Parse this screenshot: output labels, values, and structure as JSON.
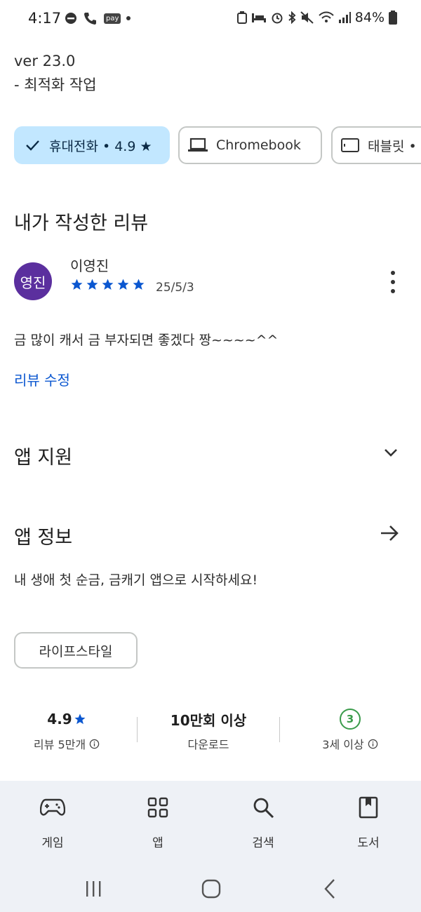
{
  "status_bar": {
    "time": "4:17",
    "pay_label": "pay",
    "battery": "84%"
  },
  "version": {
    "line1": "ver 23.0",
    "line2": "- 최적화 작업"
  },
  "device_chips": [
    {
      "label": "휴대전화 • 4.9 ★",
      "selected": true
    },
    {
      "label": "Chromebook",
      "selected": false
    },
    {
      "label": "태블릿 • ",
      "selected": false
    }
  ],
  "my_review": {
    "title": "내가 작성한 리뷰",
    "avatar_text": "영진",
    "avatar_color": "#5b2f9e",
    "reviewer": "이영진",
    "stars": 5,
    "date": "25/5/3",
    "text": "금 많이 캐서 금 부자되면 좋겠다 짱~~~~^^",
    "edit_label": "리뷰 수정"
  },
  "app_support": {
    "title": "앱 지원"
  },
  "app_info": {
    "title": "앱 정보",
    "description": "내 생애 첫 순금, 금캐기 앱으로 시작하세요!",
    "category_tag": "라이프스타일"
  },
  "stats": {
    "rating": "4.9",
    "rating_sub": "리뷰 5만개",
    "downloads": "10만회 이상",
    "downloads_sub": "다운로드",
    "age_badge": "3",
    "age_sub": "3세 이상"
  },
  "bottom_nav": [
    {
      "label": "게임",
      "icon": "gamepad-icon"
    },
    {
      "label": "앱",
      "icon": "apps-grid-icon"
    },
    {
      "label": "검색",
      "icon": "search-icon"
    },
    {
      "label": "도서",
      "icon": "book-icon"
    }
  ],
  "colors": {
    "accent": "#0b57d0",
    "chip_selected": "#c2e7ff",
    "star": "#0b57d0",
    "age_green": "#3a9b4b"
  }
}
